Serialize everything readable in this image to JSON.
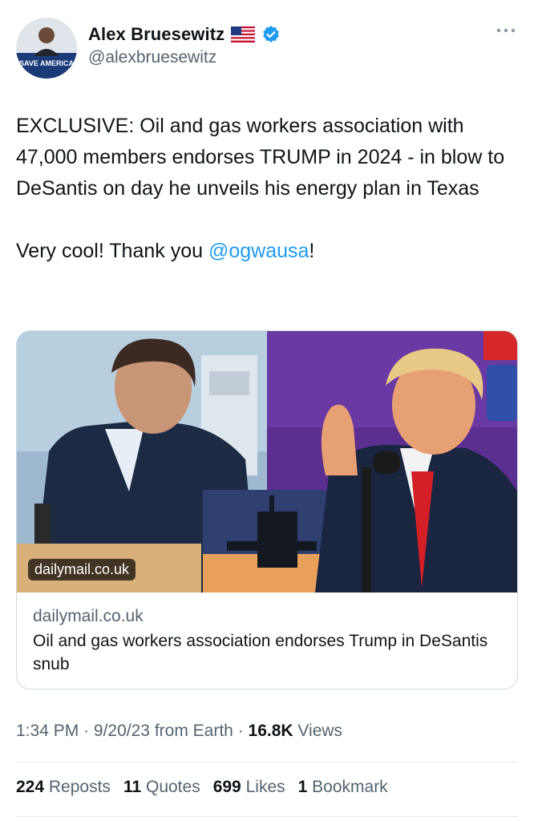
{
  "author": {
    "name": "Alex Bruesewitz",
    "flag_icon": "us-flag-icon",
    "verified_icon": "verified-badge-icon",
    "handle": "@alexbruesewitz",
    "avatar_text": "SAVE AMERICA"
  },
  "tweet": {
    "text_main": "EXCLUSIVE: Oil and gas workers association with 47,000 members endorses TRUMP in 2024 - in blow to DeSantis on day he unveils his energy plan in Texas",
    "text_thanks_prefix": "Very cool! Thank you ",
    "mention": "@ogwausa",
    "text_thanks_suffix": "!"
  },
  "card": {
    "image_badge": "dailymail.co.uk",
    "domain": "dailymail.co.uk",
    "title": "Oil and gas workers association endorses Trump in DeSantis snub"
  },
  "meta": {
    "time": "1:34 PM",
    "date": "9/20/23",
    "source": "from Earth",
    "views_count": "16.8K",
    "views_label": "Views"
  },
  "stats": {
    "reposts_count": "224",
    "reposts_label": "Reposts",
    "quotes_count": "11",
    "quotes_label": "Quotes",
    "likes_count": "699",
    "likes_label": "Likes",
    "bookmarks_count": "1",
    "bookmarks_label": "Bookmark"
  },
  "colors": {
    "link": "#1d9bf0",
    "secondary": "#536471",
    "text": "#0f1419",
    "verified": "#1d9bf0"
  }
}
